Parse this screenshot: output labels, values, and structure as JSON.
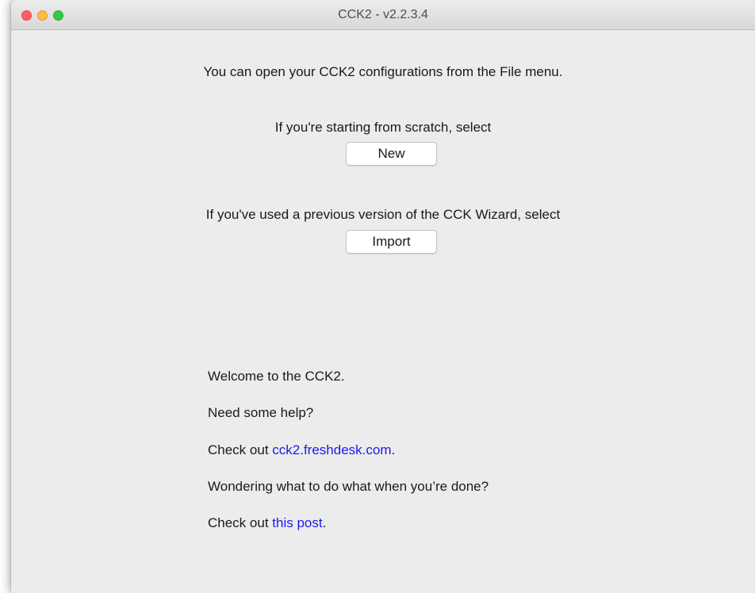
{
  "window": {
    "title": "CCK2 - v2.2.3.4"
  },
  "main": {
    "intro_text": "You can open your CCK2 configurations from the File menu.",
    "scratch_text": "If you're starting from scratch, select",
    "new_button_label": "New",
    "import_text": "If you've used a previous version of the CCK Wizard, select",
    "import_button_label": "Import"
  },
  "help": {
    "welcome": "Welcome to the CCK2.",
    "need_help": "Need some help?",
    "check_out_prefix": "Check out ",
    "freshdesk_link": "cck2.freshdesk.com",
    "period": ".",
    "wondering": "Wondering what to do what when you’re done?",
    "check_out_prefix_2": "Check out ",
    "post_link": "this post",
    "period_2": "."
  },
  "colors": {
    "link": "#1a1aee",
    "background": "#ececec",
    "close": "#fc605c",
    "minimize": "#fdbc40",
    "maximize": "#34c84a"
  }
}
